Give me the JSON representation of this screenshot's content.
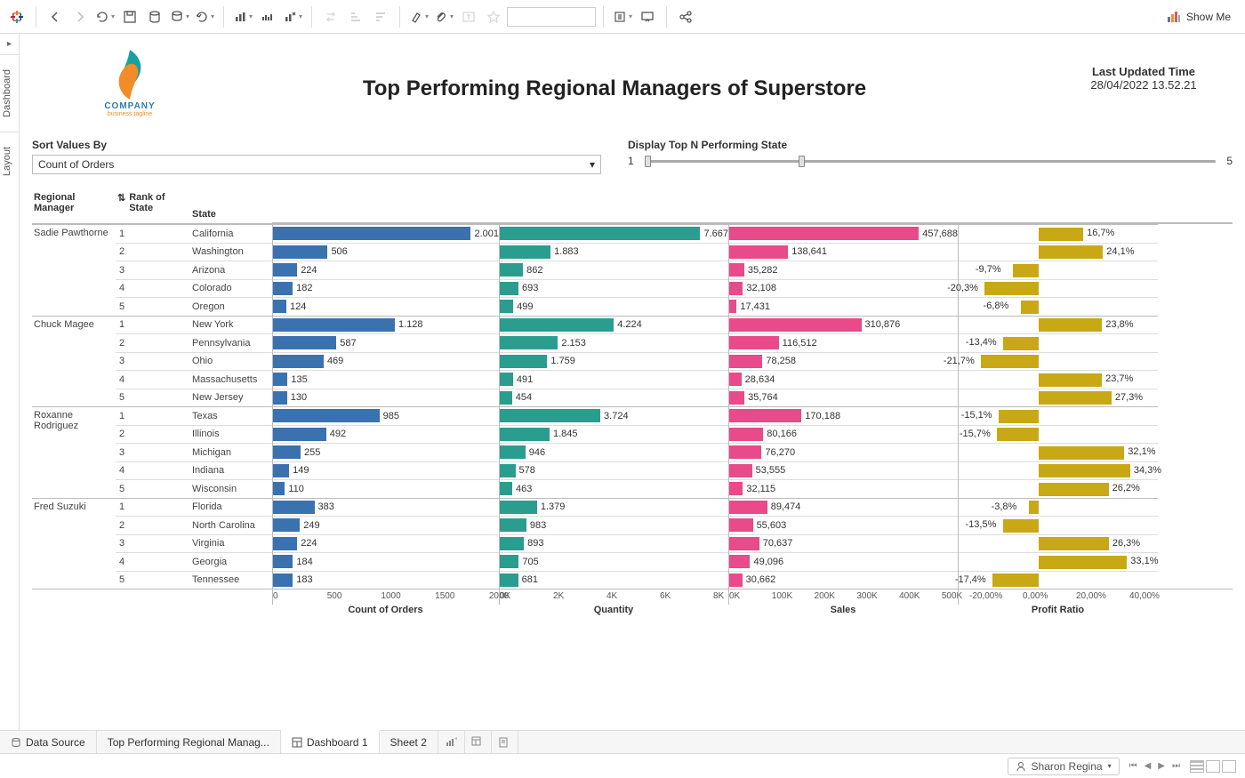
{
  "toolbar": {
    "showme": "Show Me"
  },
  "leftrail": {
    "dashboard": "Dashboard",
    "layout": "Layout"
  },
  "header": {
    "company": "COMPANY",
    "tagline": "business tagline",
    "title": "Top Performing Regional Managers of Superstore",
    "updated_label": "Last Updated Time",
    "updated_value": "28/04/2022 13.52.21"
  },
  "controls": {
    "sort_label": "Sort Values By",
    "sort_value": "Count of Orders",
    "topn_label": "Display Top N Performing State",
    "slider_min": "1",
    "slider_max": "5"
  },
  "columns": {
    "mgr": "Regional Manager",
    "rank": "Rank of State",
    "state": "State",
    "orders": "Count of Orders",
    "qty": "Quantity",
    "sales": "Sales",
    "profit": "Profit Ratio"
  },
  "axes": {
    "orders": [
      "0",
      "500",
      "1000",
      "1500",
      "2000"
    ],
    "qty": [
      "0K",
      "2K",
      "4K",
      "6K",
      "8K"
    ],
    "sales": [
      "0K",
      "100K",
      "200K",
      "300K",
      "400K",
      "500K"
    ],
    "profit": [
      "-20,00%",
      "0,00%",
      "20,00%",
      "40,00%"
    ]
  },
  "chart_data": {
    "type": "bar",
    "metrics": [
      "Count of Orders",
      "Quantity",
      "Sales",
      "Profit Ratio"
    ],
    "groups": [
      {
        "manager": "Sadie Pawthorne",
        "rows": [
          {
            "rank": "1",
            "state": "California",
            "orders": 2001,
            "orders_label": "2.001",
            "qty": 7667,
            "qty_label": "7.667",
            "sales": 457688,
            "sales_label": "457,688",
            "profit": 16.7,
            "profit_label": "16,7%"
          },
          {
            "rank": "2",
            "state": "Washington",
            "orders": 506,
            "orders_label": "506",
            "qty": 1883,
            "qty_label": "1.883",
            "sales": 138641,
            "sales_label": "138,641",
            "profit": 24.1,
            "profit_label": "24,1%"
          },
          {
            "rank": "3",
            "state": "Arizona",
            "orders": 224,
            "orders_label": "224",
            "qty": 862,
            "qty_label": "862",
            "sales": 35282,
            "sales_label": "35,282",
            "profit": -9.7,
            "profit_label": "-9,7%"
          },
          {
            "rank": "4",
            "state": "Colorado",
            "orders": 182,
            "orders_label": "182",
            "qty": 693,
            "qty_label": "693",
            "sales": 32108,
            "sales_label": "32,108",
            "profit": -20.3,
            "profit_label": "-20,3%"
          },
          {
            "rank": "5",
            "state": "Oregon",
            "orders": 124,
            "orders_label": "124",
            "qty": 499,
            "qty_label": "499",
            "sales": 17431,
            "sales_label": "17,431",
            "profit": -6.8,
            "profit_label": "-6,8%"
          }
        ]
      },
      {
        "manager": "Chuck Magee",
        "rows": [
          {
            "rank": "1",
            "state": "New York",
            "orders": 1128,
            "orders_label": "1.128",
            "qty": 4224,
            "qty_label": "4.224",
            "sales": 310876,
            "sales_label": "310,876",
            "profit": 23.8,
            "profit_label": "23,8%"
          },
          {
            "rank": "2",
            "state": "Pennsylvania",
            "orders": 587,
            "orders_label": "587",
            "qty": 2153,
            "qty_label": "2.153",
            "sales": 116512,
            "sales_label": "116,512",
            "profit": -13.4,
            "profit_label": "-13,4%"
          },
          {
            "rank": "3",
            "state": "Ohio",
            "orders": 469,
            "orders_label": "469",
            "qty": 1759,
            "qty_label": "1.759",
            "sales": 78258,
            "sales_label": "78,258",
            "profit": -21.7,
            "profit_label": "-21,7%"
          },
          {
            "rank": "4",
            "state": "Massachusetts",
            "orders": 135,
            "orders_label": "135",
            "qty": 491,
            "qty_label": "491",
            "sales": 28634,
            "sales_label": "28,634",
            "profit": 23.7,
            "profit_label": "23,7%"
          },
          {
            "rank": "5",
            "state": "New Jersey",
            "orders": 130,
            "orders_label": "130",
            "qty": 454,
            "qty_label": "454",
            "sales": 35764,
            "sales_label": "35,764",
            "profit": 27.3,
            "profit_label": "27,3%"
          }
        ]
      },
      {
        "manager": "Roxanne Rodriguez",
        "rows": [
          {
            "rank": "1",
            "state": "Texas",
            "orders": 985,
            "orders_label": "985",
            "qty": 3724,
            "qty_label": "3.724",
            "sales": 170188,
            "sales_label": "170,188",
            "profit": -15.1,
            "profit_label": "-15,1%"
          },
          {
            "rank": "2",
            "state": "Illinois",
            "orders": 492,
            "orders_label": "492",
            "qty": 1845,
            "qty_label": "1.845",
            "sales": 80166,
            "sales_label": "80,166",
            "profit": -15.7,
            "profit_label": "-15,7%"
          },
          {
            "rank": "3",
            "state": "Michigan",
            "orders": 255,
            "orders_label": "255",
            "qty": 946,
            "qty_label": "946",
            "sales": 76270,
            "sales_label": "76,270",
            "profit": 32.1,
            "profit_label": "32,1%"
          },
          {
            "rank": "4",
            "state": "Indiana",
            "orders": 149,
            "orders_label": "149",
            "qty": 578,
            "qty_label": "578",
            "sales": 53555,
            "sales_label": "53,555",
            "profit": 34.3,
            "profit_label": "34,3%"
          },
          {
            "rank": "5",
            "state": "Wisconsin",
            "orders": 110,
            "orders_label": "110",
            "qty": 463,
            "qty_label": "463",
            "sales": 32115,
            "sales_label": "32,115",
            "profit": 26.2,
            "profit_label": "26,2%"
          }
        ]
      },
      {
        "manager": "Fred Suzuki",
        "rows": [
          {
            "rank": "1",
            "state": "Florida",
            "orders": 383,
            "orders_label": "383",
            "qty": 1379,
            "qty_label": "1.379",
            "sales": 89474,
            "sales_label": "89,474",
            "profit": -3.8,
            "profit_label": "-3,8%"
          },
          {
            "rank": "2",
            "state": "North Carolina",
            "orders": 249,
            "orders_label": "249",
            "qty": 983,
            "qty_label": "983",
            "sales": 55603,
            "sales_label": "55,603",
            "profit": -13.5,
            "profit_label": "-13,5%"
          },
          {
            "rank": "3",
            "state": "Virginia",
            "orders": 224,
            "orders_label": "224",
            "qty": 893,
            "qty_label": "893",
            "sales": 70637,
            "sales_label": "70,637",
            "profit": 26.3,
            "profit_label": "26,3%"
          },
          {
            "rank": "4",
            "state": "Georgia",
            "orders": 184,
            "orders_label": "184",
            "qty": 705,
            "qty_label": "705",
            "sales": 49096,
            "sales_label": "49,096",
            "profit": 33.1,
            "profit_label": "33,1%"
          },
          {
            "rank": "5",
            "state": "Tennessee",
            "orders": 183,
            "orders_label": "183",
            "qty": 681,
            "qty_label": "681",
            "sales": 30662,
            "sales_label": "30,662",
            "profit": -17.4,
            "profit_label": "-17,4%"
          }
        ]
      }
    ],
    "scales": {
      "orders_max": 2100,
      "qty_max": 8500,
      "sales_max": 540000,
      "profit_min": -30,
      "profit_max": 45
    }
  },
  "footer": {
    "datasource": "Data Source",
    "sheet1": "Top Performing Regional Manag...",
    "dashboard": "Dashboard 1",
    "sheet2": "Sheet 2"
  },
  "status": {
    "user": "Sharon Regina"
  }
}
